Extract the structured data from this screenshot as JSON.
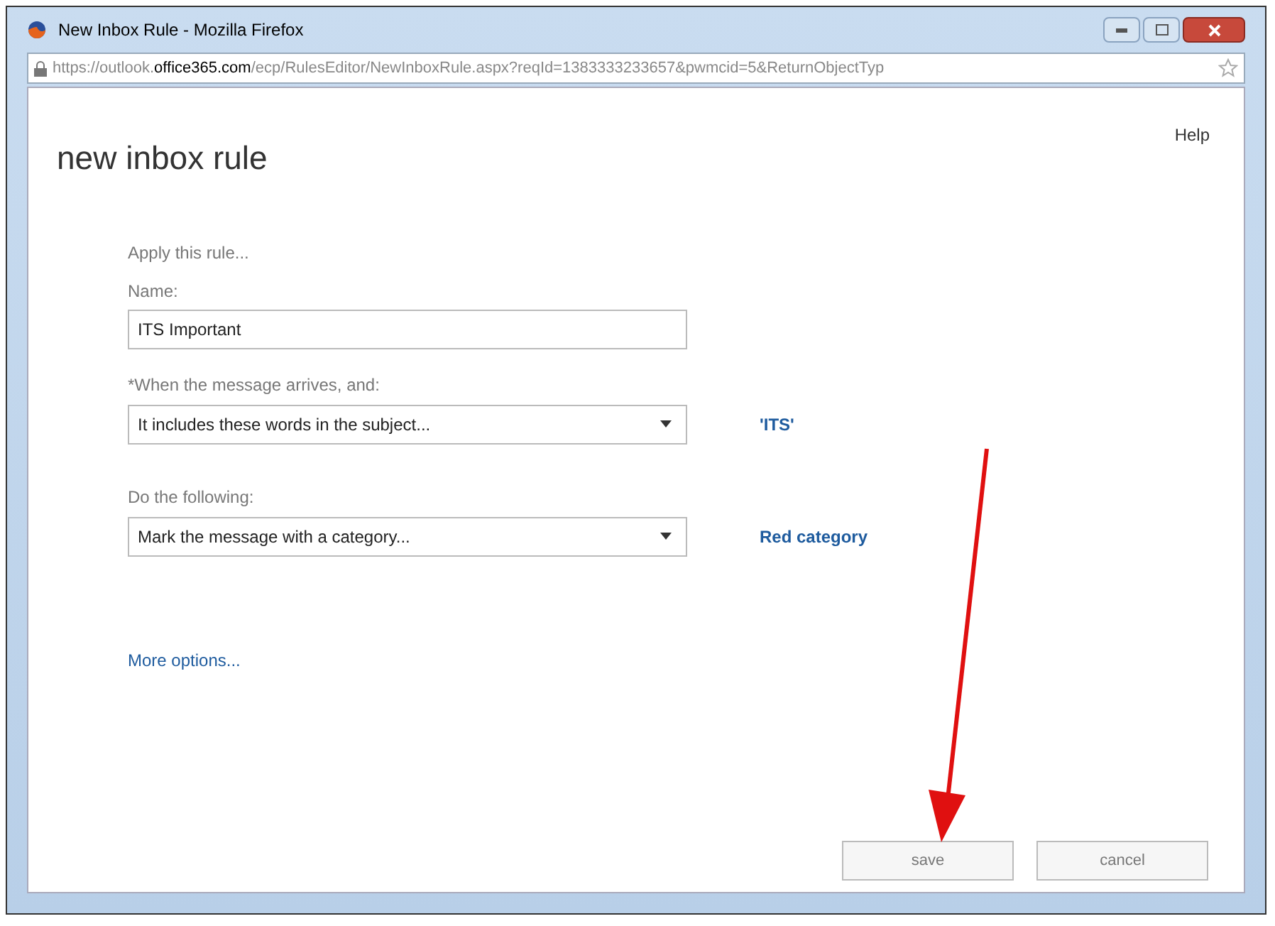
{
  "window": {
    "title": "New Inbox Rule - Mozilla Firefox"
  },
  "address_bar": {
    "url_prefix": "https://outlook.",
    "url_domain": "office365.com",
    "url_path": "/ecp/RulesEditor/NewInboxRule.aspx?reqId=1383333233657&pwmcid=5&ReturnObjectTyp"
  },
  "page": {
    "title": "new inbox rule",
    "help": "Help"
  },
  "form": {
    "intro": "Apply this rule...",
    "name": {
      "label": "Name:",
      "value": "ITS Important"
    },
    "conditions": [
      {
        "label": "*When the message arrives, and:",
        "value": "It includes these words in the subject...",
        "link": "'ITS'"
      },
      {
        "label": "Do the following:",
        "value": "Mark the message with a category...",
        "link": "Red category"
      }
    ],
    "more_options": "More options..."
  },
  "buttons": [
    {
      "label": "save"
    },
    {
      "label": "cancel"
    }
  ]
}
